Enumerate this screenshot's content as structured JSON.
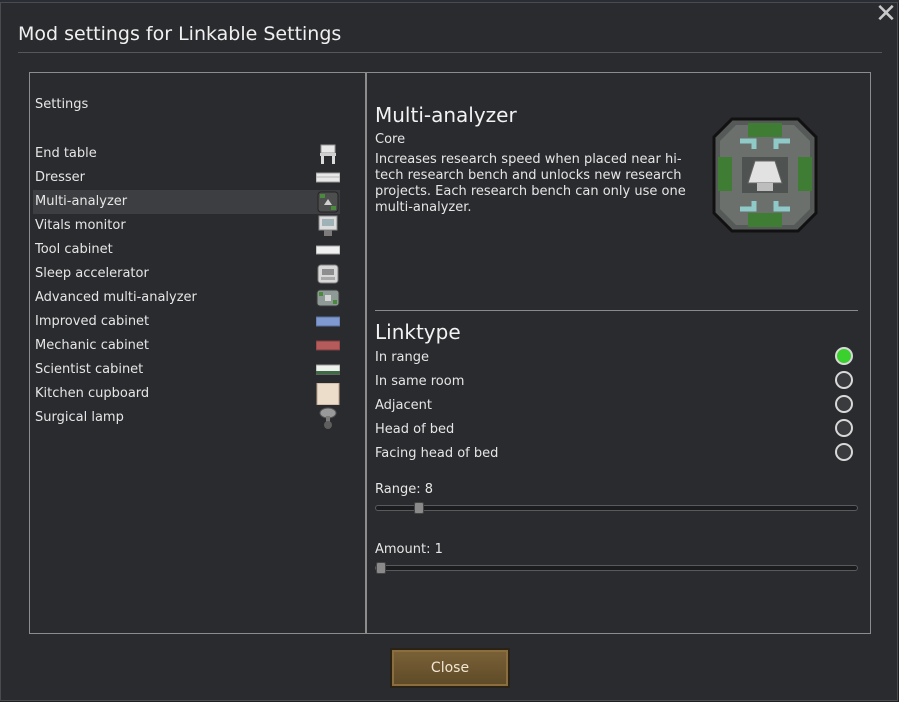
{
  "window": {
    "title": "Mod settings for Linkable Settings",
    "close_icon": "close-x-icon",
    "close_button_label": "Close",
    "close_button_color": "#6b5530"
  },
  "sidebar": {
    "header": "Settings",
    "selected_index": 2,
    "items": [
      {
        "label": "End table",
        "icon": "end-table-icon"
      },
      {
        "label": "Dresser",
        "icon": "dresser-icon"
      },
      {
        "label": "Multi-analyzer",
        "icon": "multi-analyzer-icon"
      },
      {
        "label": "Vitals monitor",
        "icon": "vitals-monitor-icon"
      },
      {
        "label": "Tool cabinet",
        "icon": "tool-cabinet-icon"
      },
      {
        "label": "Sleep accelerator",
        "icon": "sleep-accelerator-icon"
      },
      {
        "label": "Advanced multi-analyzer",
        "icon": "advanced-multi-analyzer-icon"
      },
      {
        "label": "Improved cabinet",
        "icon": "improved-cabinet-icon"
      },
      {
        "label": "Mechanic cabinet",
        "icon": "mechanic-cabinet-icon"
      },
      {
        "label": "Scientist cabinet",
        "icon": "scientist-cabinet-icon"
      },
      {
        "label": "Kitchen cupboard",
        "icon": "kitchen-cupboard-icon"
      },
      {
        "label": "Surgical lamp",
        "icon": "surgical-lamp-icon"
      }
    ]
  },
  "detail": {
    "title": "Multi-analyzer",
    "category": "Core",
    "description": "Increases research speed when placed near hi-tech research bench and unlocks new research projects. Each research bench can only use one multi-analyzer.",
    "icon": "multi-analyzer-large-icon"
  },
  "linktype": {
    "title": "Linktype",
    "options": [
      {
        "label": "In range",
        "selected": true
      },
      {
        "label": "In same room",
        "selected": false
      },
      {
        "label": "Adjacent",
        "selected": false
      },
      {
        "label": "Head of bed",
        "selected": false
      },
      {
        "label": "Facing head of bed",
        "selected": false
      }
    ],
    "selected_color": "#3ad12e"
  },
  "sliders": {
    "range": {
      "label": "Range: 8",
      "fraction": 0.08
    },
    "amount": {
      "label": "Amount: 1",
      "fraction": 0.0
    }
  }
}
